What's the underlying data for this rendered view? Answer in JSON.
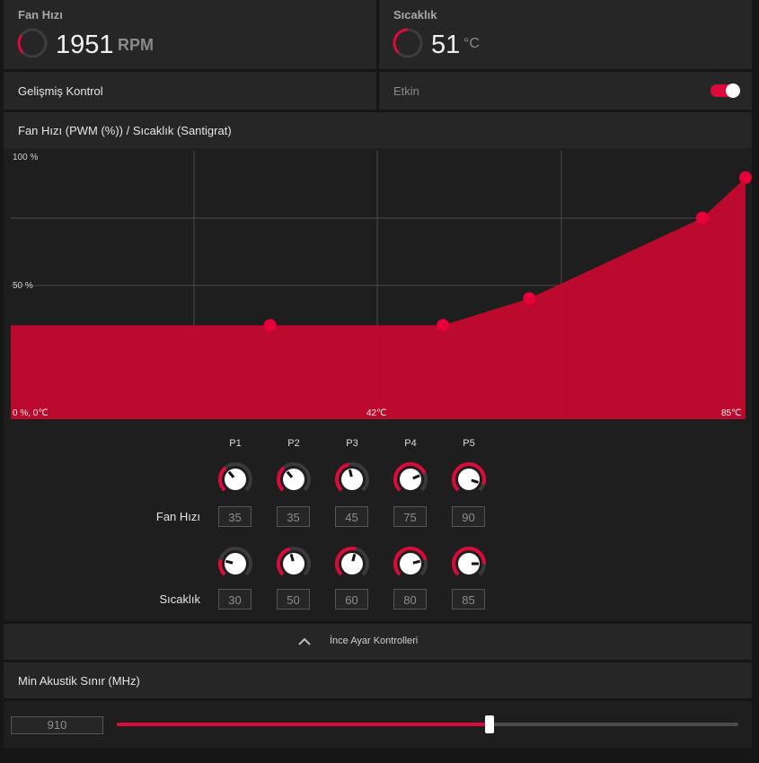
{
  "fan_speed": {
    "label": "Fan Hızı",
    "value": "1951",
    "unit": "RPM",
    "gauge_fraction": 0.3
  },
  "temperature": {
    "label": "Sıcaklık",
    "value": "51",
    "unit": "°C",
    "gauge_fraction": 0.5
  },
  "advanced": {
    "label": "Gelişmiş Kontrol",
    "state_label": "Etkin",
    "enabled": true
  },
  "curve": {
    "title": "Fan Hızı (PWM (%)) / Sıcaklık (Santigrat)",
    "y_top_label": "100 %",
    "y_mid_label": "50 %",
    "origin_label": "0 %, 0℃",
    "x_mid_label": "42℃",
    "x_max_label": "85℃"
  },
  "chart_data": {
    "type": "area",
    "x": [
      30,
      50,
      60,
      80,
      85
    ],
    "y": [
      35,
      35,
      45,
      75,
      90
    ],
    "xlim": [
      0,
      85
    ],
    "ylim": [
      0,
      100
    ],
    "xlabel": "",
    "ylabel": "",
    "grid": true
  },
  "points": {
    "labels": [
      "P1",
      "P2",
      "P3",
      "P4",
      "P5"
    ],
    "fan_label": "Fan Hızı",
    "temp_label": "Sıcaklık",
    "fan_values": [
      "35",
      "35",
      "45",
      "75",
      "90"
    ],
    "temp_values": [
      "30",
      "50",
      "60",
      "80",
      "85"
    ]
  },
  "fine_tune": {
    "label": "İnce Ayar Kontrolleri"
  },
  "acoustic": {
    "label": "Min Akustik Sınır (MHz)",
    "value": "910",
    "slider_fraction": 0.6
  },
  "colors": {
    "accent": "#dc0a3a",
    "panel": "#262626",
    "background": "#161616"
  },
  "icons": {
    "collapse": "chevron-up-icon"
  }
}
